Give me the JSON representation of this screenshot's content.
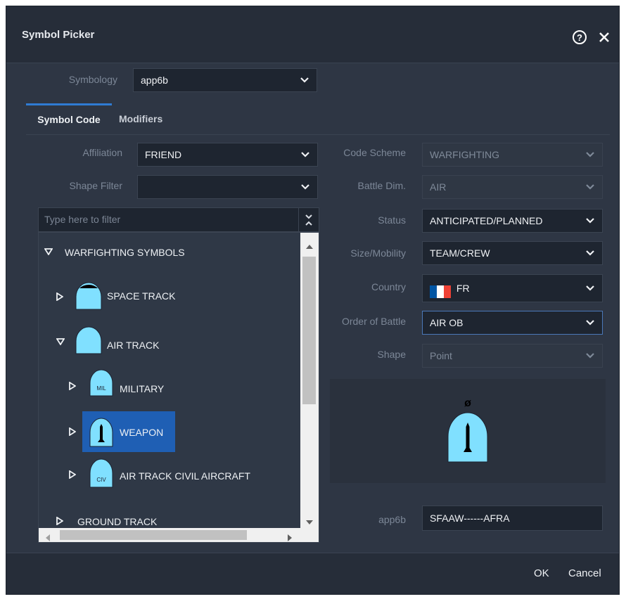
{
  "dialog": {
    "title": "Symbol Picker",
    "help_icon": "help-icon",
    "close_icon": "close-icon"
  },
  "symbology": {
    "label": "Symbology",
    "value": "app6b"
  },
  "tabs": [
    {
      "label": "Symbol Code"
    },
    {
      "label": "Modifiers"
    }
  ],
  "affiliation": {
    "label": "Affiliation",
    "value": "FRIEND"
  },
  "shape_filter": {
    "label": "Shape Filter",
    "value": ""
  },
  "code_scheme": {
    "label": "Code Scheme",
    "value": "WARFIGHTING"
  },
  "battle_dim": {
    "label": "Battle Dim.",
    "value": "AIR"
  },
  "status": {
    "label": "Status",
    "value": "ANTICIPATED/PLANNED"
  },
  "size_mobility": {
    "label": "Size/Mobility",
    "value": "TEAM/CREW"
  },
  "country": {
    "label": "Country",
    "value": "FR",
    "flag_colors": [
      "#0055a4",
      "#ffffff",
      "#ef4135"
    ]
  },
  "order_of_battle": {
    "label": "Order of Battle",
    "value": "AIR OB"
  },
  "shape": {
    "label": "Shape",
    "value": "Point"
  },
  "filter": {
    "placeholder": "Type here to filter"
  },
  "tree": {
    "items": [
      {
        "label": "WARFIGHTING SYMBOLS",
        "expanded": true
      },
      {
        "label": "SPACE TRACK",
        "expanded": false
      },
      {
        "label": "AIR TRACK",
        "expanded": true
      },
      {
        "label": "MILITARY",
        "expanded": false,
        "badge": "MIL"
      },
      {
        "label": "WEAPON",
        "expanded": false,
        "selected": true
      },
      {
        "label": "AIR TRACK CIVIL AIRCRAFT",
        "expanded": false,
        "badge": "CIV"
      },
      {
        "label": "GROUND TRACK",
        "expanded": false
      }
    ]
  },
  "preview": {
    "status_mark": "ø"
  },
  "code": {
    "label": "app6b",
    "value": "SFAAW------AFRA"
  },
  "footer": {
    "ok": "OK",
    "cancel": "Cancel"
  },
  "colors": {
    "accent": "#2f7bd3",
    "selection": "#1f5fb4",
    "symbol_fill": "#80e0ff",
    "background": "#2e3644"
  }
}
